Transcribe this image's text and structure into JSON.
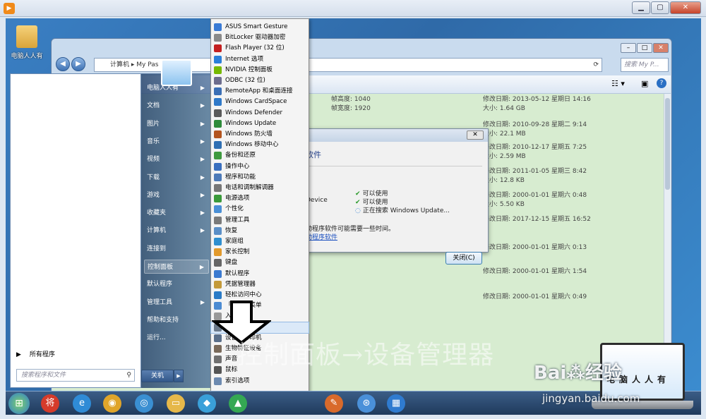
{
  "desktop": {
    "icon_label": "电脑人人有"
  },
  "explorer": {
    "path_root": "计算机",
    "path_folder": "My Pas",
    "search_placeholder": "搜索 My P...",
    "nav_back": "◀",
    "nav_forward": "▶",
    "refresh_icon": "⟳",
    "files": [
      {
        "a1": "帧高度: 1040",
        "a2": "帧宽度: 1920",
        "l1": "修改日期: 2013-05-12 星期日 14:16",
        "l2": "大小: 1.64 GB"
      },
      {
        "a1": "",
        "a2": "",
        "l1": "修改日期: 2010-09-28 星期二 9:14",
        "l2": "大小: 22.1 MB"
      },
      {
        "a1": "",
        "a2": "",
        "l1": "修改日期: 2010-12-17 星期五 7:25",
        "l2": "大小: 2.59 MB"
      },
      {
        "a1": "",
        "a2": "",
        "l1": "修改日期: 2011-01-05 星期三 8:42",
        "l2": "大小: 12.8 KB"
      },
      {
        "a1": "",
        "a2": "",
        "l1": "修改日期: 2000-01-01 星期六 0:48",
        "l2": "大小: 5.50 KB"
      },
      {
        "a1": "",
        "a2": "",
        "l1": "修改日期: 2017-12-15 星期五 16:52",
        "l2": ""
      },
      {
        "a1": "",
        "a2": "",
        "l1": "修改日期: 2000-01-01 星期六 0:13",
        "l2": ""
      },
      {
        "a1": "",
        "a2": "",
        "l1": "修改日期: 2000-01-01 星期六 1:54",
        "l2": ""
      },
      {
        "a1": "",
        "a2": "",
        "l1": "修改日期: 2000-01-01 星期六 0:49",
        "l2": ""
      }
    ]
  },
  "dialog": {
    "heading": "软件",
    "device": "Device",
    "status": [
      {
        "mark": "✔",
        "text": "可以使用"
      },
      {
        "mark": "✔",
        "text": "可以使用"
      },
      {
        "mark": "◌",
        "text": "正在搜索 Windows Update..."
      }
    ],
    "note": "动程序软件可能需要一些时间。",
    "link": "动程序软件",
    "close_button": "关闭(C)",
    "x": "✕"
  },
  "start_menu": {
    "all_programs": "所有程序",
    "all_programs_arrow": "▶",
    "search_placeholder": "搜索程序和文件",
    "search_icon": "⚲",
    "shutdown": "关机",
    "shutdown_arrow": "▶",
    "right_items": [
      {
        "label": "电脑人人有",
        "arrow": "▶"
      },
      {
        "label": "文档",
        "arrow": "▶"
      },
      {
        "label": "图片",
        "arrow": "▶"
      },
      {
        "label": "音乐",
        "arrow": "▶"
      },
      {
        "label": "视频",
        "arrow": "▶"
      },
      {
        "label": "下载",
        "arrow": "▶"
      },
      {
        "label": "游戏",
        "arrow": "▶"
      },
      {
        "label": "收藏夹",
        "arrow": "▶"
      },
      {
        "label": "计算机",
        "arrow": "▶"
      },
      {
        "label": "连接到",
        "arrow": ""
      },
      {
        "label": "控制面板",
        "arrow": "▶"
      },
      {
        "label": "默认程序",
        "arrow": ""
      },
      {
        "label": "管理工具",
        "arrow": "▶"
      },
      {
        "label": "帮助和支持",
        "arrow": ""
      },
      {
        "label": "运行...",
        "arrow": ""
      }
    ]
  },
  "control_panel": {
    "more": "▼",
    "items": [
      {
        "label": "ASUS Smart Gesture",
        "color": "#3a7bd5"
      },
      {
        "label": "BitLocker 驱动器加密",
        "color": "#8a8a8a"
      },
      {
        "label": "Flash Player (32 位)",
        "color": "#c42020"
      },
      {
        "label": "Internet 选项",
        "color": "#2a7fd9"
      },
      {
        "label": "NVIDIA 控制面板",
        "color": "#76b900"
      },
      {
        "label": "ODBC (32 位)",
        "color": "#6d6d8d"
      },
      {
        "label": "RemoteApp 和桌面连接",
        "color": "#3b6fb5"
      },
      {
        "label": "Windows CardSpace",
        "color": "#2f79c9"
      },
      {
        "label": "Windows Defender",
        "color": "#5a5a5a"
      },
      {
        "label": "Windows Update",
        "color": "#2e8b3a"
      },
      {
        "label": "Windows 防火墙",
        "color": "#b3541e"
      },
      {
        "label": "Windows 移动中心",
        "color": "#2f6fb3"
      },
      {
        "label": "备份和还原",
        "color": "#3f9a3f"
      },
      {
        "label": "操作中心",
        "color": "#3a6fbf"
      },
      {
        "label": "程序和功能",
        "color": "#4d7ab8"
      },
      {
        "label": "电话和调制解调器",
        "color": "#777"
      },
      {
        "label": "电源选项",
        "color": "#3a9a3a"
      },
      {
        "label": "个性化",
        "color": "#4a8fd6"
      },
      {
        "label": "管理工具",
        "color": "#7a7a7a"
      },
      {
        "label": "恢复",
        "color": "#5b8fc7"
      },
      {
        "label": "家庭组",
        "color": "#2f8fd0"
      },
      {
        "label": "家长控制",
        "color": "#e29a2c"
      },
      {
        "label": "键盘",
        "color": "#666"
      },
      {
        "label": "默认程序",
        "color": "#3b7ad0"
      },
      {
        "label": "凭据管理器",
        "color": "#c49a3a"
      },
      {
        "label": "轻松访问中心",
        "color": "#2a7bc7"
      },
      {
        "label": "「开始」菜单",
        "color": "#4c8bd2"
      },
      {
        "label": "入",
        "color": "#999"
      },
      {
        "label": "设备管理器",
        "color": "#6b7a8c"
      },
      {
        "label": "设备和打印机",
        "color": "#5a6f8a"
      },
      {
        "label": "生物特征设备",
        "color": "#7a6a5a"
      },
      {
        "label": "声音",
        "color": "#707070"
      },
      {
        "label": "鼠标",
        "color": "#555"
      },
      {
        "label": "索引选项",
        "color": "#6d8ab0"
      }
    ]
  },
  "caption": "控制面板→设备管理器",
  "watermark": {
    "logo": "Bai⁂经验",
    "url": "jingyan.baidu.com",
    "laptop_text": "电脑人人有"
  },
  "player": {
    "min": "▁",
    "max": "▢",
    "close": "✕",
    "logo": "▶"
  },
  "taskbar": {
    "start": "⊞",
    "apps": [
      {
        "name": "app-360",
        "glyph": "将",
        "color": "#d53b2b"
      },
      {
        "name": "ie",
        "glyph": "e",
        "color": "#2f8bd6"
      },
      {
        "name": "chrome",
        "glyph": "◉",
        "color": "#e0a52a"
      },
      {
        "name": "browser2",
        "glyph": "◎",
        "color": "#3a8fd2"
      },
      {
        "name": "folder",
        "glyph": "▭",
        "color": "#e6b84a"
      },
      {
        "name": "app6",
        "glyph": "◆",
        "color": "#3aa0d9"
      },
      {
        "name": "app7",
        "glyph": "▲",
        "color": "#34a853"
      }
    ],
    "right_apps": [
      {
        "name": "paint",
        "glyph": "✎",
        "color": "#d96a2b"
      },
      {
        "name": "network",
        "glyph": "⊛",
        "color": "#4a90d9"
      },
      {
        "name": "tool",
        "glyph": "▦",
        "color": "#2f7bd0"
      }
    ]
  }
}
